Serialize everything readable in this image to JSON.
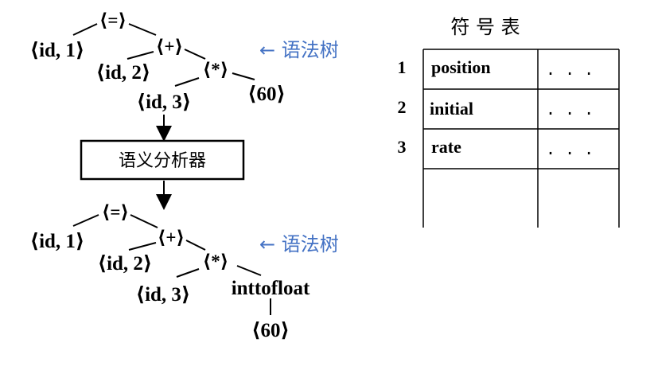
{
  "tree_top": {
    "root": "⟨=⟩",
    "id1": "⟨id, 1⟩",
    "plus": "⟨+⟩",
    "id2": "⟨id, 2⟩",
    "mul": "⟨*⟩",
    "id3": "⟨id, 3⟩",
    "num60": "⟨60⟩",
    "label": "← 语法树"
  },
  "analyzer": "语义分析器",
  "tree_bottom": {
    "root": "⟨=⟩",
    "id1": "⟨id, 1⟩",
    "plus": "⟨+⟩",
    "id2": "⟨id, 2⟩",
    "mul": "⟨*⟩",
    "id3": "⟨id, 3⟩",
    "conv": "inttofloat",
    "num60": "⟨60⟩",
    "label": "← 语法树"
  },
  "symbol_table": {
    "title": "符 号 表",
    "rows": [
      {
        "num": "1",
        "name": "position",
        "attr": ". . ."
      },
      {
        "num": "2",
        "name": "initial",
        "attr": ". . ."
      },
      {
        "num": "3",
        "name": "rate",
        "attr": ". . ."
      },
      {
        "num": "",
        "name": "",
        "attr": ""
      }
    ]
  },
  "colors": {
    "label": "#4472C4",
    "line": "#000000"
  }
}
